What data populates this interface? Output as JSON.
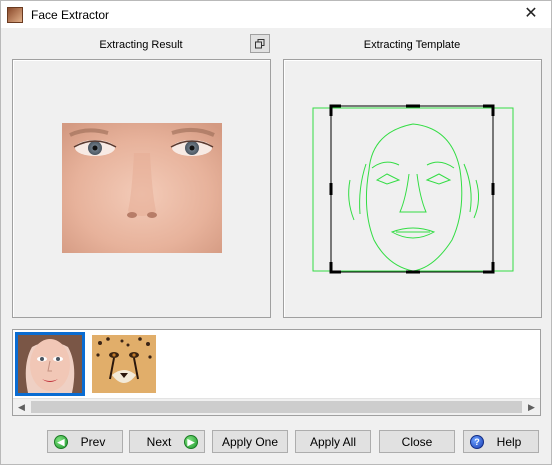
{
  "window": {
    "title": "Face Extractor",
    "close_glyph": "✕"
  },
  "panels": {
    "left_label": "Extracting Result",
    "right_label": "Extracting Template"
  },
  "icons": {
    "app": "face-extractor-app-icon",
    "restore": "restore-window-icon",
    "prev": "arrow-left-circle-icon",
    "next": "arrow-right-circle-icon",
    "help": "question-circle-icon"
  },
  "thumbnails": [
    {
      "subject": "woman-face",
      "selected": true
    },
    {
      "subject": "cheetah-face",
      "selected": false
    }
  ],
  "scrollbar": {
    "left_glyph": "◀",
    "right_glyph": "▶"
  },
  "buttons": {
    "prev": "Prev",
    "next": "Next",
    "apply_one": "Apply One",
    "apply_all": "Apply All",
    "close": "Close",
    "help": "Help"
  },
  "colors": {
    "template_green": "#33dd44",
    "selection_blue": "#0a6cd2"
  }
}
